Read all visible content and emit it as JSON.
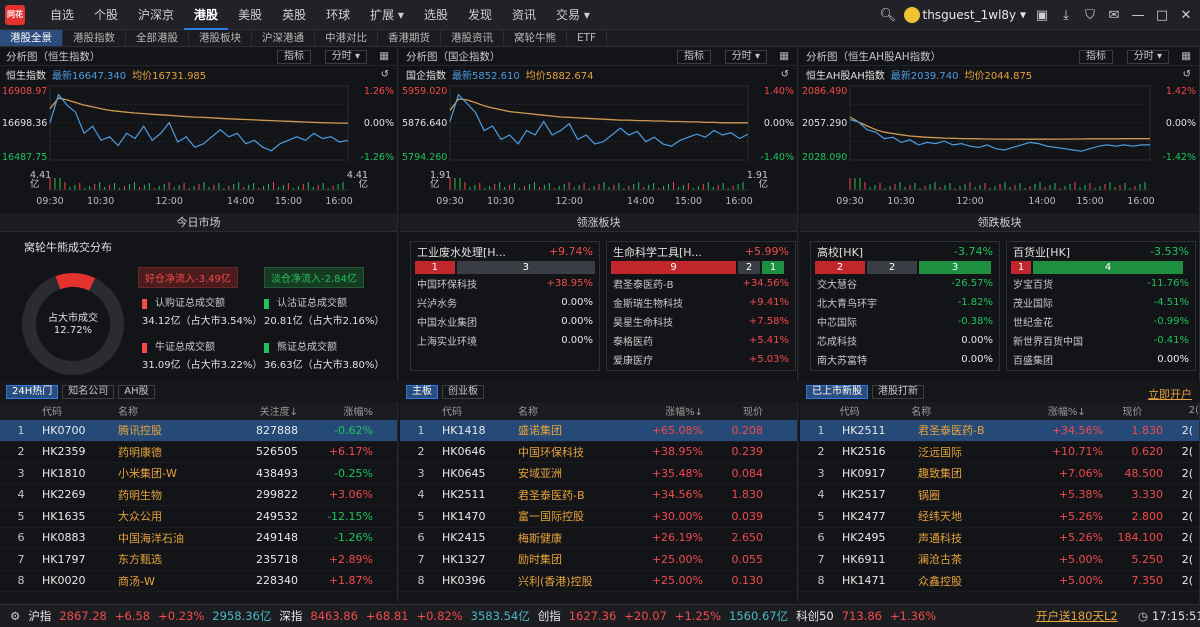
{
  "logo": "同花顺",
  "nav": [
    "自选",
    "个股",
    "沪深京",
    "港股",
    "美股",
    "英股",
    "环球",
    "扩展 ▾",
    "选股",
    "发现",
    "资讯",
    "交易 ▾"
  ],
  "nav_active": 3,
  "user": "thsguest_1wl8y",
  "icons": [
    "search-icon",
    "avatar",
    "wallet-icon",
    "download-icon",
    "shirt-icon",
    "mail-icon",
    "minimize-icon",
    "maximize-icon",
    "close-icon"
  ],
  "subtabs": [
    "港股全景",
    "港股指数",
    "全部港股",
    "港股板块",
    "沪深港通",
    "中港对比",
    "香港期货",
    "港股资讯",
    "窝轮牛熊",
    "ETF"
  ],
  "pane_btn_index": "指标",
  "pane_btn_period": "分时 ▾",
  "panes": [
    {
      "title": "分析图（恒生指数）",
      "name": "恒生指数",
      "latest": "最新16647.340",
      "avg": "均价16731.985",
      "high": "16908.97",
      "mid": "16698.36",
      "low": "16487.75",
      "pct_hi": "1.26%",
      "pct_mid": "0.00%",
      "pct_lo": "-1.26%",
      "vol_l": "4.41",
      "vol_r": "4.41",
      "vol_l2": "亿",
      "vol_r2": "亿",
      "price": [
        16700,
        16860,
        16800,
        16760,
        16640,
        16680,
        16600,
        16620,
        16570,
        16640,
        16610,
        16680,
        16600,
        16640,
        16700,
        16590,
        16620,
        16560,
        16580,
        16620,
        16660,
        16620,
        16640,
        16580,
        16600,
        16560,
        16540,
        16580,
        16600,
        16620,
        16600,
        16640,
        16610,
        16620,
        16590,
        16600
      ],
      "avgline": [
        16780,
        16840,
        16830,
        16815,
        16800,
        16790,
        16780,
        16770,
        16765,
        16760,
        16755,
        16752,
        16748,
        16745,
        16742,
        16738,
        16735,
        16732,
        16730,
        16728,
        16725,
        16722,
        16720,
        16718,
        16716,
        16714,
        16712,
        16710,
        16708,
        16706,
        16704,
        16702,
        16700,
        16699,
        16698,
        16697
      ],
      "price_range": [
        16487.75,
        16908.97
      ]
    },
    {
      "title": "分析图（国企指数）",
      "name": "国企指数",
      "latest": "最新5852.610",
      "avg": "均价5882.674",
      "high": "5959.020",
      "mid": "5876.640",
      "low": "5794.260",
      "pct_hi": "1.40%",
      "pct_mid": "0.00%",
      "pct_lo": "-1.40%",
      "vol_l": "1.91",
      "vol_r": "1.91",
      "vol_l2": "亿",
      "vol_r2": "亿",
      "price": [
        5880,
        5940,
        5920,
        5900,
        5860,
        5870,
        5840,
        5850,
        5830,
        5860,
        5850,
        5880,
        5850,
        5860,
        5875,
        5840,
        5850,
        5830,
        5835,
        5850,
        5865,
        5850,
        5858,
        5835,
        5845,
        5830,
        5825,
        5838,
        5845,
        5852,
        5845,
        5860,
        5850,
        5855,
        5842,
        5852
      ],
      "avgline": [
        5905,
        5930,
        5928,
        5922,
        5915,
        5910,
        5906,
        5902,
        5900,
        5898,
        5896,
        5894,
        5892,
        5890,
        5889,
        5888,
        5887,
        5886,
        5885,
        5884,
        5883,
        5883,
        5882,
        5882,
        5881,
        5881,
        5880,
        5880,
        5879,
        5879,
        5878,
        5878,
        5877,
        5877,
        5877,
        5877
      ],
      "price_range": [
        5794.26,
        5959.02
      ]
    },
    {
      "title": "分析图（恒生AH股AH指数）",
      "name": "恒生AH股AH指数",
      "latest": "最新2039.740",
      "avg": "均价2044.875",
      "high": "2086.490",
      "mid": "2057.290",
      "low": "2028.090",
      "pct_hi": "1.42%",
      "pct_mid": "0.00%",
      "pct_lo": "-1.42%",
      "vol_l": "",
      "vol_r": "",
      "vol_l2": "",
      "vol_r2": "",
      "price": [
        2060,
        2058,
        2052,
        2050,
        2045,
        2046,
        2042,
        2044,
        2040,
        2042,
        2041,
        2043,
        2040,
        2041,
        2039,
        2038,
        2040,
        2037,
        2036,
        2038,
        2040,
        2042,
        2041,
        2039,
        2038,
        2037,
        2036,
        2035,
        2037,
        2039,
        2040,
        2039,
        2040,
        2039,
        2040,
        2040
      ],
      "avgline": [
        2062,
        2058,
        2055,
        2052,
        2050,
        2049,
        2048,
        2047,
        2046.5,
        2046,
        2045.7,
        2045.4,
        2045.2,
        2045,
        2044.9,
        2044.8,
        2044.7,
        2044.6,
        2044.6,
        2044.5,
        2044.5,
        2044.5,
        2044.5,
        2044.5,
        2044.6,
        2044.6,
        2044.7,
        2044.7,
        2044.8,
        2044.8,
        2044.8,
        2044.8,
        2044.9,
        2044.9,
        2044.9,
        2044.9
      ],
      "price_range": [
        2028.09,
        2086.49
      ]
    }
  ],
  "time_ticks": [
    "09:30",
    "10:30",
    "12:00",
    "14:00",
    "15:00",
    "16:00"
  ],
  "sec_titles": [
    "今日市场",
    "领涨板块",
    "领跌板块"
  ],
  "market": {
    "title": "窝轮牛熊成交分布",
    "center1": "占大市成交",
    "center2": "12.72%",
    "bull_flow": "好仓净流入-3.49亿",
    "bear_flow": "淡仓净流入-2.84亿",
    "items": [
      {
        "label": "认购证总成交额",
        "val": "34.12亿（占大市3.54%）"
      },
      {
        "label": "认沽证总成交额",
        "val": "20.81亿（占大市2.16%）"
      },
      {
        "label": "牛证总成交额",
        "val": "31.09亿（占大市3.22%）"
      },
      {
        "label": "熊证总成交额",
        "val": "36.63亿（占大市3.80%）"
      }
    ],
    "donut_share": 0.1272
  },
  "rise_sectors": [
    {
      "name": "工业废水处理[H...",
      "pct": "+9.74%",
      "bars": [
        {
          "n": "1",
          "c": "#c0262b",
          "w": 40
        },
        {
          "n": "",
          "c": "#3a3d44",
          "w": 0
        },
        {
          "n": "3",
          "c": "#3a3d44",
          "w": 140
        }
      ],
      "rows": [
        [
          "中国环保科技",
          "+38.95%"
        ],
        [
          "兴泸水务",
          "0.00%"
        ],
        [
          "中国水业集团",
          "0.00%"
        ],
        [
          "上海实业环境",
          "0.00%"
        ]
      ]
    },
    {
      "name": "生命科学工具[H...",
      "pct": "+5.99%",
      "bars": [
        {
          "n": "9",
          "c": "#c0262b",
          "w": 125
        },
        {
          "n": "2",
          "c": "#3a3d44",
          "w": 22
        },
        {
          "n": "1",
          "c": "#1e8f3e",
          "w": 22
        }
      ],
      "rows": [
        [
          "君圣泰医药-B",
          "+34.56%"
        ],
        [
          "金斯瑞生物科技",
          "+9.41%"
        ],
        [
          "昊星生命科技",
          "+7.58%"
        ],
        [
          "泰格医药",
          "+5.41%"
        ],
        [
          "爱康医疗",
          "+5.03%"
        ]
      ]
    }
  ],
  "fall_sectors": [
    {
      "name": "高校[HK]",
      "pct": "-3.74%",
      "bars": [
        {
          "n": "2",
          "c": "#c0262b",
          "w": 50
        },
        {
          "n": "2",
          "c": "#3a3d44",
          "w": 50
        },
        {
          "n": "3",
          "c": "#1e8f3e",
          "w": 72
        }
      ],
      "rows": [
        [
          "交大慧谷",
          "-26.57%"
        ],
        [
          "北大青鸟环宇",
          "-1.82%"
        ],
        [
          "中芯国际",
          "-0.38%"
        ],
        [
          "芯成科技",
          "0.00%"
        ],
        [
          "南大苏富特",
          "0.00%"
        ]
      ]
    },
    {
      "name": "百货业[HK]",
      "pct": "-3.53%",
      "bars": [
        {
          "n": "1",
          "c": "#c0262b",
          "w": 20
        },
        {
          "n": "4",
          "c": "#1e8f3e",
          "w": 150
        }
      ],
      "rows": [
        [
          "岁宝百货",
          "-11.76%"
        ],
        [
          "茂业国际",
          "-4.51%"
        ],
        [
          "世纪金花",
          "-0.99%"
        ],
        [
          "新世界百货中国",
          "-0.41%"
        ],
        [
          "百盛集团",
          "0.00%"
        ]
      ]
    }
  ],
  "tabs_left": [
    "24H热门",
    "知名公司",
    "AH股"
  ],
  "tabs_mid": [
    "主板",
    "创业板"
  ],
  "tabs_right": [
    "已上市新股",
    "港股打新"
  ],
  "ipo_link": "立即开户",
  "tbl1_hdr": [
    "",
    "代码",
    "名称",
    "关注度↓",
    "涨幅%"
  ],
  "tbl1": [
    [
      "1",
      "HK0700",
      "腾讯控股",
      "827888",
      "-0.62%"
    ],
    [
      "2",
      "HK2359",
      "药明康德",
      "526505",
      "+6.17%"
    ],
    [
      "3",
      "HK1810",
      "小米集团-W",
      "438493",
      "-0.25%"
    ],
    [
      "4",
      "HK2269",
      "药明生物",
      "299822",
      "+3.06%"
    ],
    [
      "5",
      "HK1635",
      "大众公用",
      "249532",
      "-12.15%"
    ],
    [
      "6",
      "HK0883",
      "中国海洋石油",
      "249148",
      "-1.26%"
    ],
    [
      "7",
      "HK1797",
      "东方甄选",
      "235718",
      "+2.89%"
    ],
    [
      "8",
      "HK0020",
      "商汤-W",
      "228340",
      "+1.87%"
    ]
  ],
  "tbl2_hdr": [
    "",
    "代码",
    "名称",
    "涨幅%↓",
    "现价"
  ],
  "tbl2": [
    [
      "1",
      "HK1418",
      "盛诺集团",
      "+65.08%",
      "0.208"
    ],
    [
      "2",
      "HK0646",
      "中国环保科技",
      "+38.95%",
      "0.239"
    ],
    [
      "3",
      "HK0645",
      "安域亚洲",
      "+35.48%",
      "0.084"
    ],
    [
      "4",
      "HK2511",
      "君圣泰医药-B",
      "+34.56%",
      "1.830"
    ],
    [
      "5",
      "HK1470",
      "富一国际控股",
      "+30.00%",
      "0.039"
    ],
    [
      "6",
      "HK2415",
      "梅斯健康",
      "+26.19%",
      "2.650"
    ],
    [
      "7",
      "HK1327",
      "励时集团",
      "+25.00%",
      "0.055"
    ],
    [
      "8",
      "HK0396",
      "兴利(香港)控股",
      "+25.00%",
      "0.130"
    ]
  ],
  "tbl3_hdr": [
    "",
    "代码",
    "名称",
    "涨幅%↓",
    "现价",
    "2("
  ],
  "tbl3": [
    [
      "1",
      "HK2511",
      "君圣泰医药-B",
      "+34.56%",
      "1.830",
      "2("
    ],
    [
      "2",
      "HK2516",
      "泛远国际",
      "+10.71%",
      "0.620",
      "2("
    ],
    [
      "3",
      "HK0917",
      "趣致集团",
      "+7.06%",
      "48.500",
      "2("
    ],
    [
      "4",
      "HK2517",
      "锅圈",
      "+5.38%",
      "3.330",
      "2("
    ],
    [
      "5",
      "HK2477",
      "经纬天地",
      "+5.26%",
      "2.800",
      "2("
    ],
    [
      "6",
      "HK2495",
      "声通科技",
      "+5.26%",
      "184.100",
      "2("
    ],
    [
      "7",
      "HK6911",
      "澜沧古茶",
      "+5.00%",
      "5.250",
      "2("
    ],
    [
      "8",
      "HK1471",
      "众鑫控股",
      "+5.00%",
      "7.350",
      "2("
    ]
  ],
  "bottom": {
    "sh": "沪指",
    "sh_v": "2867.28",
    "sh_c": "+6.58",
    "sh_p": "+0.23%",
    "sh_a": "2958.36亿",
    "sz": "深指",
    "sz_v": "8463.86",
    "sz_c": "+68.81",
    "sz_p": "+0.82%",
    "sz_a": "3583.54亿",
    "cy": "创指",
    "cy_v": "1627.36",
    "cy_c": "+20.07",
    "cy_p": "+1.25%",
    "cy_a": "1560.67亿",
    "kc": "科创50",
    "kc_v": "713.86",
    "kc_p": "+1.36%",
    "promo": "开户送180天L2",
    "time": "17:15:51"
  }
}
